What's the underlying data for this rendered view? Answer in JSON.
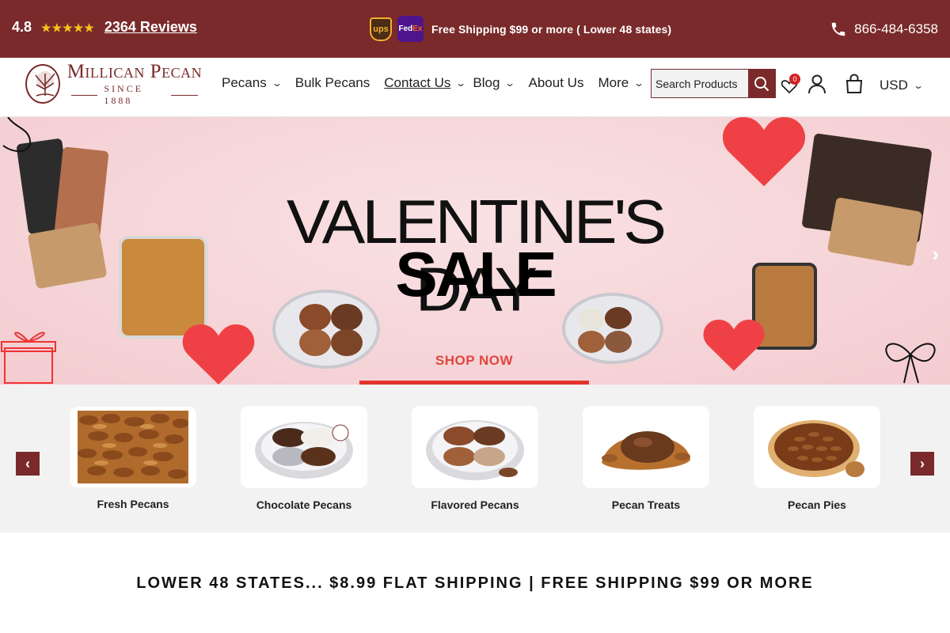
{
  "topbar": {
    "rating_score": "4.8",
    "star_count": 5,
    "reviews_label": "2364 Reviews",
    "shipping_text": "Free Shipping $99 or more ( Lower 48 states)",
    "ups_label": "ups",
    "fedex_fe": "Fed",
    "fedex_ex": "Ex",
    "phone": "866-484-6358",
    "bg_color": "#7a2a2a"
  },
  "header": {
    "logo_name": "Millican Pecan",
    "logo_since": "SINCE 1888",
    "nav": [
      {
        "label": "Pecans",
        "has_dropdown": true
      },
      {
        "label": "Bulk Pecans",
        "has_dropdown": false
      },
      {
        "label": "Contact Us",
        "has_dropdown": true
      },
      {
        "label": "Blog",
        "has_dropdown": true
      },
      {
        "label": "About Us",
        "has_dropdown": false
      },
      {
        "label": "More",
        "has_dropdown": true
      }
    ],
    "search_placeholder": "Search Products",
    "wishlist_count": "0",
    "currency": "USD"
  },
  "hero": {
    "title_line1": "VALENTINE'S DAY",
    "title_line2": "SALE",
    "cta": "SHOP NOW",
    "cta_color": "#e0463f"
  },
  "categories": [
    {
      "label": "Fresh Pecans",
      "icon": "pecan-halves-image"
    },
    {
      "label": "Chocolate Pecans",
      "icon": "chocolate-tin-image"
    },
    {
      "label": "Flavored Pecans",
      "icon": "flavored-tin-image"
    },
    {
      "label": "Pecan Treats",
      "icon": "pecan-turtle-image"
    },
    {
      "label": "Pecan Pies",
      "icon": "pecan-pie-image"
    }
  ],
  "notice": {
    "text": "LOWER 48 STATES... $8.99 FLAT SHIPPING | FREE SHIPPING $99 OR MORE"
  }
}
